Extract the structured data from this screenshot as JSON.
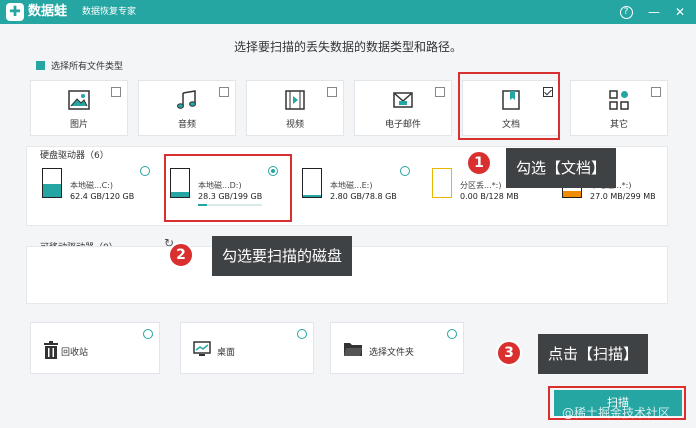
{
  "titlebar": {
    "logo_glyph": "✚",
    "app_name": "数据蛙",
    "slogan": "数据恢复专家",
    "help_glyph": "?",
    "minimize_glyph": "—",
    "close_glyph": "✕"
  },
  "instruction": "选择要扫描的丢失数据的数据类型和路径。",
  "select_all_label": "选择所有文件类型",
  "file_types": [
    {
      "label": "图片",
      "icon": "image-icon",
      "checked": false
    },
    {
      "label": "音频",
      "icon": "music-icon",
      "checked": false
    },
    {
      "label": "视频",
      "icon": "video-icon",
      "checked": false
    },
    {
      "label": "电子邮件",
      "icon": "email-icon",
      "checked": false
    },
    {
      "label": "文档",
      "icon": "document-icon",
      "checked": true
    },
    {
      "label": "其它",
      "icon": "other-icon",
      "checked": false
    }
  ],
  "hard_drives": {
    "title": "硬盘驱动器（6）",
    "items": [
      {
        "name": "本地磁...C:)",
        "size": "62.4 GB/120 GB",
        "used": 0.52,
        "selected": false
      },
      {
        "name": "本地磁...D:)",
        "size": "28.3 GB/199 GB",
        "used": 0.14,
        "selected": true
      },
      {
        "name": "本地磁...E:)",
        "size": "2.80 GB/78.8 GB",
        "used": 0.04,
        "selected": false
      },
      {
        "name": "分区丢...*:)",
        "size": "0.00  B/128 MB",
        "used": 0.0,
        "selected": false
      },
      {
        "name": "本地磁...*:)",
        "size": "27.0 MB/299 MB",
        "used": 0.09,
        "selected": false
      }
    ]
  },
  "removable": {
    "title": "可移动驱动器（0）",
    "refresh_glyph": "↻"
  },
  "locations": [
    {
      "label": "回收站",
      "icon": "recycle-bin-icon"
    },
    {
      "label": "桌面",
      "icon": "desktop-icon"
    },
    {
      "label": "选择文件夹",
      "icon": "folder-icon"
    }
  ],
  "scan_button": "扫描",
  "annotations": [
    {
      "number": "1",
      "text": "勾选【文档】"
    },
    {
      "number": "2",
      "text": "勾选要扫描的磁盘"
    },
    {
      "number": "3",
      "text": "点击【扫描】"
    }
  ],
  "watermark": "@稀土掘金技术社区",
  "colors": {
    "accent": "#25a6a3",
    "highlight": "#d9302f",
    "callout": "#3f4244"
  }
}
